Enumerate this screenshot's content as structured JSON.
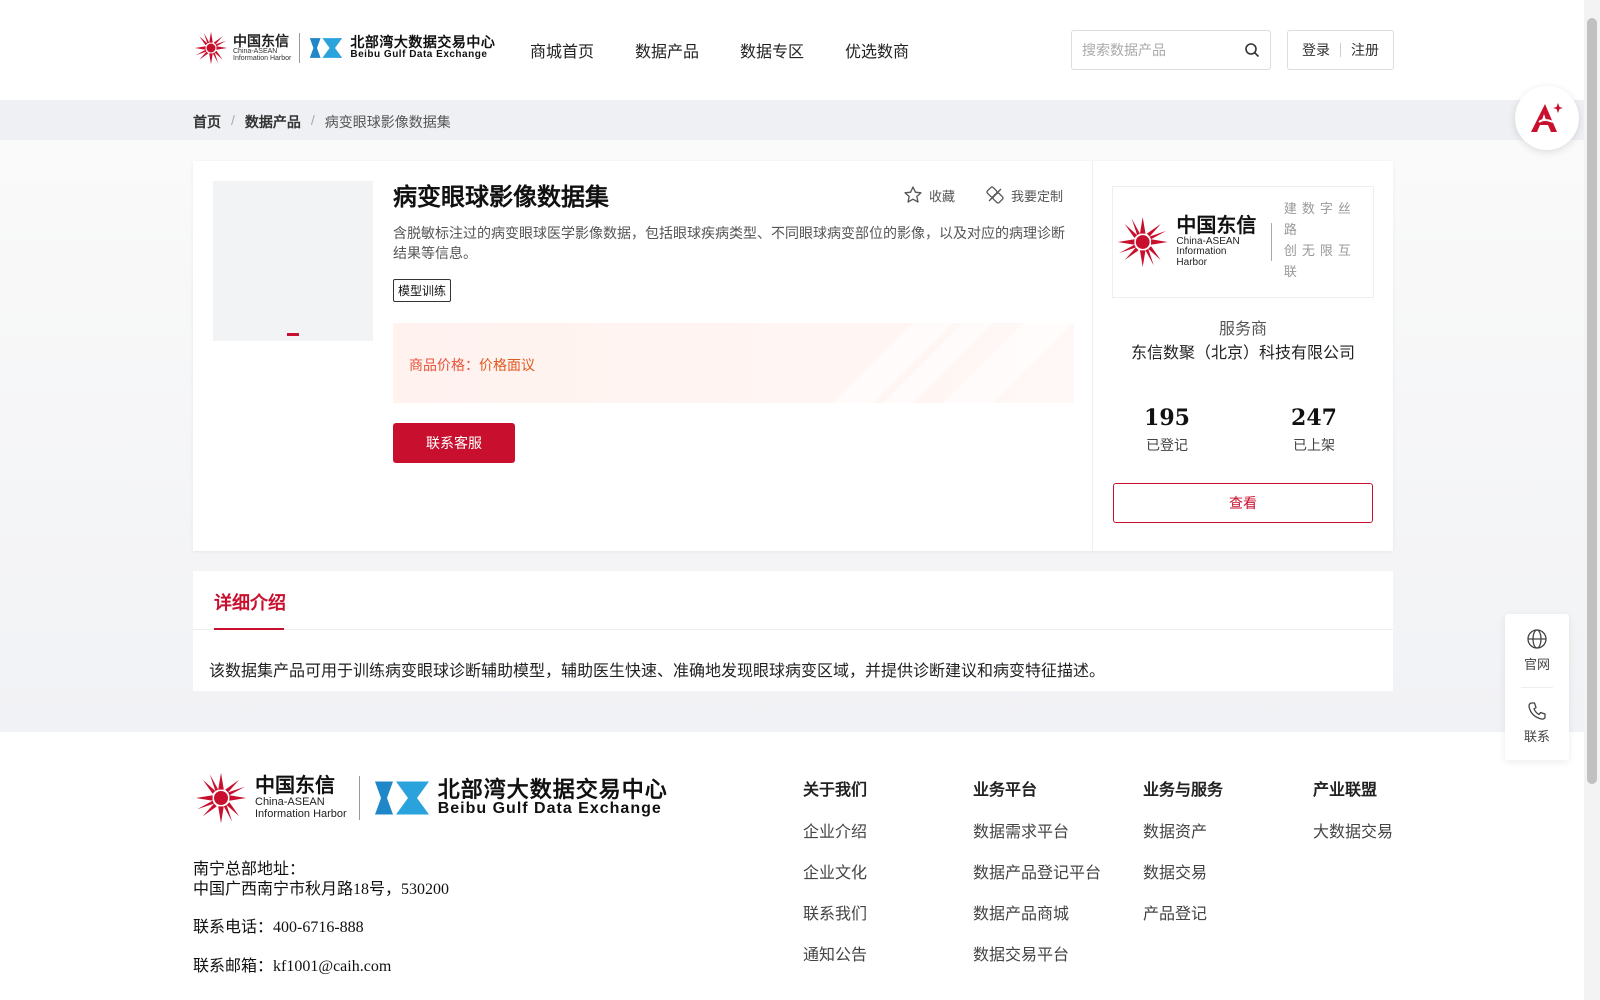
{
  "header": {
    "logo_ct_cn": "中国东信",
    "logo_ct_en_1": "China-ASEAN",
    "logo_ct_en_2": "Information Harbor",
    "logo_bb_cn": "北部湾大数据交易中心",
    "logo_bb_en": "Beibu Gulf Data Exchange",
    "nav": [
      "商城首页",
      "数据产品",
      "数据专区",
      "优选数商"
    ],
    "search_placeholder": "搜索数据产品",
    "login": "登录",
    "register": "注册"
  },
  "breadcrumb": [
    "首页",
    "数据产品",
    "病变眼球影像数据集"
  ],
  "product": {
    "title": "病变眼球影像数据集",
    "favorite_label": "收藏",
    "customize_label": "我要定制",
    "description": "含脱敏标注过的病变眼球医学影像数据，包括眼球疾病类型、不同眼球病变部位的影像，以及对应的病理诊断结果等信息。",
    "tag": "模型训练",
    "price_label": "商品价格：",
    "price_value": "价格面议",
    "contact_button": "联系客服"
  },
  "vendor": {
    "logo_cn": "中国东信",
    "logo_en_1": "China-ASEAN",
    "logo_en_2": "Information Harbor",
    "slogan_1": "建数字丝路",
    "slogan_2": "创无限互联",
    "role": "服务商",
    "name": "东信数聚（北京）科技有限公司",
    "registered_count": "195",
    "registered_label": "已登记",
    "listed_count": "247",
    "listed_label": "已上架",
    "view_button": "查看"
  },
  "detail": {
    "tab": "详细介绍",
    "text": "该数据集产品可用于训练病变眼球诊断辅助模型，辅助医生快速、准确地发现眼球病变区域，并提供诊断建议和病变特征描述。"
  },
  "footer": {
    "address_label": "南宁总部地址：",
    "address": "中国广西南宁市秋月路18号，530200",
    "phone_label": "联系电话：",
    "phone": "400-6716-888",
    "email_label": "联系邮箱：",
    "email": "kf1001@caih.com",
    "columns": [
      {
        "title": "关于我们",
        "items": [
          "企业介绍",
          "企业文化",
          "联系我们",
          "通知公告"
        ]
      },
      {
        "title": "业务平台",
        "items": [
          "数据需求平台",
          "数据产品登记平台",
          "数据产品商城",
          "数据交易平台"
        ]
      },
      {
        "title": "业务与服务",
        "items": [
          "数据资产",
          "数据交易",
          "产品登记"
        ]
      },
      {
        "title": "产业联盟",
        "items": [
          "大数据交易"
        ]
      }
    ]
  },
  "float": {
    "official": "官网",
    "contact": "联系"
  },
  "colors": {
    "brand_red": "#c8102e",
    "price_orange": "#e3581f",
    "bb_blue": "#1f86c8"
  },
  "icons": [
    "search-icon",
    "star-icon",
    "customize-icon",
    "globe-icon",
    "phone-icon",
    "ai-assistant-icon"
  ]
}
